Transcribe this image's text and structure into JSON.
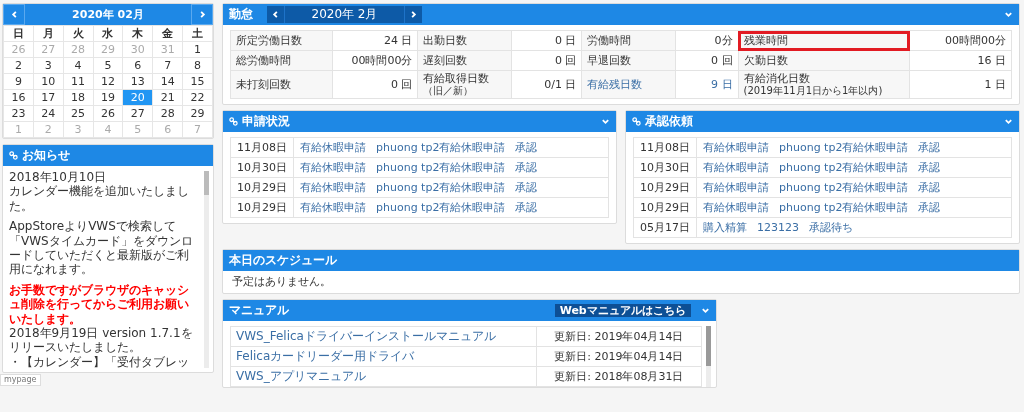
{
  "calendar": {
    "title": "2020年 02月",
    "weekdays": [
      "日",
      "月",
      "火",
      "水",
      "木",
      "金",
      "土"
    ],
    "weeks": [
      [
        {
          "day": "26",
          "muted": true,
          "selected": false
        },
        {
          "day": "27",
          "muted": true,
          "selected": false
        },
        {
          "day": "28",
          "muted": true,
          "selected": false
        },
        {
          "day": "29",
          "muted": true,
          "selected": false
        },
        {
          "day": "30",
          "muted": true,
          "selected": false
        },
        {
          "day": "31",
          "muted": true,
          "selected": false
        },
        {
          "day": "1",
          "muted": false,
          "selected": false
        }
      ],
      [
        {
          "day": "2",
          "muted": false,
          "selected": false
        },
        {
          "day": "3",
          "muted": false,
          "selected": false
        },
        {
          "day": "4",
          "muted": false,
          "selected": false
        },
        {
          "day": "5",
          "muted": false,
          "selected": false
        },
        {
          "day": "6",
          "muted": false,
          "selected": false
        },
        {
          "day": "7",
          "muted": false,
          "selected": false
        },
        {
          "day": "8",
          "muted": false,
          "selected": false
        }
      ],
      [
        {
          "day": "9",
          "muted": false,
          "selected": false
        },
        {
          "day": "10",
          "muted": false,
          "selected": false
        },
        {
          "day": "11",
          "muted": false,
          "selected": false
        },
        {
          "day": "12",
          "muted": false,
          "selected": false
        },
        {
          "day": "13",
          "muted": false,
          "selected": false
        },
        {
          "day": "14",
          "muted": false,
          "selected": false
        },
        {
          "day": "15",
          "muted": false,
          "selected": false
        }
      ],
      [
        {
          "day": "16",
          "muted": false,
          "selected": false
        },
        {
          "day": "17",
          "muted": false,
          "selected": false
        },
        {
          "day": "18",
          "muted": false,
          "selected": false
        },
        {
          "day": "19",
          "muted": false,
          "selected": false
        },
        {
          "day": "20",
          "muted": false,
          "selected": true
        },
        {
          "day": "21",
          "muted": false,
          "selected": false
        },
        {
          "day": "22",
          "muted": false,
          "selected": false
        }
      ],
      [
        {
          "day": "23",
          "muted": false,
          "selected": false
        },
        {
          "day": "24",
          "muted": false,
          "selected": false
        },
        {
          "day": "25",
          "muted": false,
          "selected": false
        },
        {
          "day": "26",
          "muted": false,
          "selected": false
        },
        {
          "day": "27",
          "muted": false,
          "selected": false
        },
        {
          "day": "28",
          "muted": false,
          "selected": false
        },
        {
          "day": "29",
          "muted": false,
          "selected": false
        }
      ],
      [
        {
          "day": "1",
          "muted": true,
          "selected": false
        },
        {
          "day": "2",
          "muted": true,
          "selected": false
        },
        {
          "day": "3",
          "muted": true,
          "selected": false
        },
        {
          "day": "4",
          "muted": true,
          "selected": false
        },
        {
          "day": "5",
          "muted": true,
          "selected": false
        },
        {
          "day": "6",
          "muted": true,
          "selected": false
        },
        {
          "day": "7",
          "muted": true,
          "selected": false
        }
      ]
    ]
  },
  "notice": {
    "title": "お知らせ",
    "blocks": [
      {
        "kind": "note",
        "lines": [
          "2018年10月10日",
          "カレンダー機能を追加いたしました。"
        ]
      },
      {
        "kind": "note",
        "lines": [
          "AppStoreよりVWSで検索して「VWSタイムカード」をダウンロードしていただくと最新版がご利用になれます。"
        ]
      },
      {
        "kind": "alert",
        "lines": [
          "お手数ですがブラウザのキャッシュ削除を行ってからご利用お願いいたします。"
        ]
      },
      {
        "kind": "note",
        "lines": [
          "2018年9月19日 version 1.7.1をリリースいたしました。",
          "・【カレンダー】「受付タブレッ"
        ]
      }
    ]
  },
  "status_text": "mypage",
  "attendance": {
    "title": "勤怠",
    "month": "2020年 2月",
    "rows": [
      [
        {
          "label": "所定労働日数",
          "value": "24 日",
          "link": false,
          "highlighted": false
        },
        {
          "label": "出勤日数",
          "value": "0 日",
          "link": false,
          "highlighted": false
        },
        {
          "label": "労働時間",
          "value": "0分",
          "link": false,
          "highlighted": false
        },
        {
          "label": "残業時間",
          "value": "00時間00分",
          "link": false,
          "highlighted": true
        }
      ],
      [
        {
          "label": "総労働時間",
          "value": "00時間00分",
          "link": false,
          "highlighted": false
        },
        {
          "label": "遅刻回数",
          "value": "0 回",
          "link": false,
          "highlighted": false
        },
        {
          "label": "早退回数",
          "value": "0 回",
          "link": false,
          "highlighted": false
        },
        {
          "label": "欠勤日数",
          "value": "16 日",
          "link": false,
          "highlighted": false
        }
      ],
      [
        {
          "label": "未打刻回数",
          "value": "0 回",
          "link": false,
          "highlighted": false
        },
        {
          "label": "有給取得日数",
          "sublabel": "（旧／新）",
          "value": "0/1 日",
          "link": false,
          "highlighted": false
        },
        {
          "label": "有給残日数",
          "value": "9 日",
          "link": true,
          "highlighted": false
        },
        {
          "label": "有給消化日数",
          "sublabel": "(2019年11月1日から1年以内)",
          "value": "1 日",
          "link": false,
          "highlighted": false
        }
      ]
    ]
  },
  "requests": [
    {
      "title": "申請状況",
      "rows": [
        {
          "date": "11月08日",
          "type": "有給休暇申請",
          "detail": "phuong tp2有給休暇申請",
          "status": "承認"
        },
        {
          "date": "10月30日",
          "type": "有給休暇申請",
          "detail": "phuong tp2有給休暇申請",
          "status": "承認"
        },
        {
          "date": "10月29日",
          "type": "有給休暇申請",
          "detail": "phuong tp2有給休暇申請",
          "status": "承認"
        },
        {
          "date": "10月29日",
          "type": "有給休暇申請",
          "detail": "phuong tp2有給休暇申請",
          "status": "承認"
        }
      ]
    },
    {
      "title": "承認依頼",
      "rows": [
        {
          "date": "11月08日",
          "type": "有給休暇申請",
          "detail": "phuong tp2有給休暇申請",
          "status": "承認"
        },
        {
          "date": "10月30日",
          "type": "有給休暇申請",
          "detail": "phuong tp2有給休暇申請",
          "status": "承認"
        },
        {
          "date": "10月29日",
          "type": "有給休暇申請",
          "detail": "phuong tp2有給休暇申請",
          "status": "承認"
        },
        {
          "date": "10月29日",
          "type": "有給休暇申請",
          "detail": "phuong tp2有給休暇申請",
          "status": "承認"
        },
        {
          "date": "05月17日",
          "type": "購入精算",
          "detail": "123123",
          "status": "承認待ち"
        }
      ]
    }
  ],
  "schedule": {
    "title": "本日のスケジュール",
    "message": "予定はありません。"
  },
  "manual": {
    "title": "マニュアル",
    "web_button": "Webマニュアルはこちら",
    "rows": [
      {
        "name": "VWS_Felicaドライバーインストールマニュアル",
        "updated": "更新日: 2019年04月14日"
      },
      {
        "name": "Felicaカードリーダー用ドライバ",
        "updated": "更新日: 2019年04月14日"
      },
      {
        "name": "VWS_アプリマニュアル",
        "updated": "更新日: 2018年08月31日"
      }
    ]
  }
}
